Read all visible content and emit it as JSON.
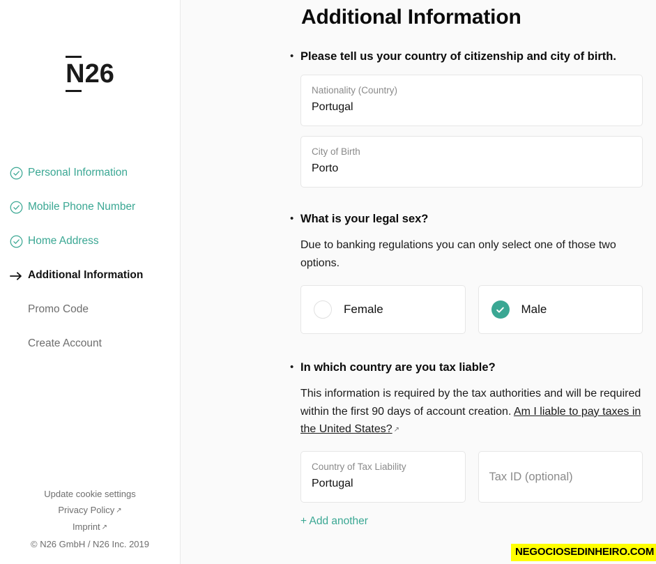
{
  "brand": {
    "logo_text": "N26"
  },
  "sidebar": {
    "items": [
      {
        "label": "Personal Information",
        "state": "done",
        "icon": "check-circle-icon"
      },
      {
        "label": "Mobile Phone Number",
        "state": "done",
        "icon": "check-circle-icon"
      },
      {
        "label": "Home Address",
        "state": "done",
        "icon": "check-circle-icon"
      },
      {
        "label": "Additional Information",
        "state": "active",
        "icon": "arrow-right-icon"
      },
      {
        "label": "Promo Code",
        "state": "todo",
        "icon": "none"
      },
      {
        "label": "Create Account",
        "state": "todo",
        "icon": "none"
      }
    ],
    "footer": {
      "cookie_settings": "Update cookie settings",
      "privacy_policy": "Privacy Policy",
      "imprint": "Imprint",
      "copyright": "© N26 GmbH / N26 Inc. 2019",
      "external_glyph": "↗"
    }
  },
  "main": {
    "title": "Additional Information",
    "bullet_glyph": "•",
    "sections": {
      "citizenship": {
        "question": "Please tell us your country of citizenship and city of birth.",
        "nationality": {
          "label": "Nationality (Country)",
          "value": "Portugal"
        },
        "city_of_birth": {
          "label": "City of Birth",
          "value": "Porto"
        }
      },
      "legal_sex": {
        "question": "What is your legal sex?",
        "description": "Due to banking regulations you can only select one of those two options.",
        "options": [
          {
            "label": "Female",
            "selected": false
          },
          {
            "label": "Male",
            "selected": true
          }
        ]
      },
      "tax": {
        "question": "In which country are you tax liable?",
        "description_part1": "This information is required by the tax authorities and will be required within the first 90 days of account creation. ",
        "link_text": "Am I liable to pay taxes in the United States?",
        "link_glyph": "↗",
        "country_field": {
          "label": "Country of Tax Liability",
          "value": "Portugal"
        },
        "tax_id_field": {
          "placeholder": "Tax ID (optional)",
          "value": ""
        },
        "add_another": "+ Add another"
      }
    }
  },
  "watermark": {
    "text": "NEGOCIOSEDINHEIRO.COM"
  },
  "colors": {
    "accent_teal": "#3aa793",
    "text_primary": "#0b0b0b",
    "text_muted": "#6e6e6e",
    "field_border": "#e6e6e6",
    "main_bg": "#fafafa",
    "watermark_bg": "#ffff00"
  }
}
